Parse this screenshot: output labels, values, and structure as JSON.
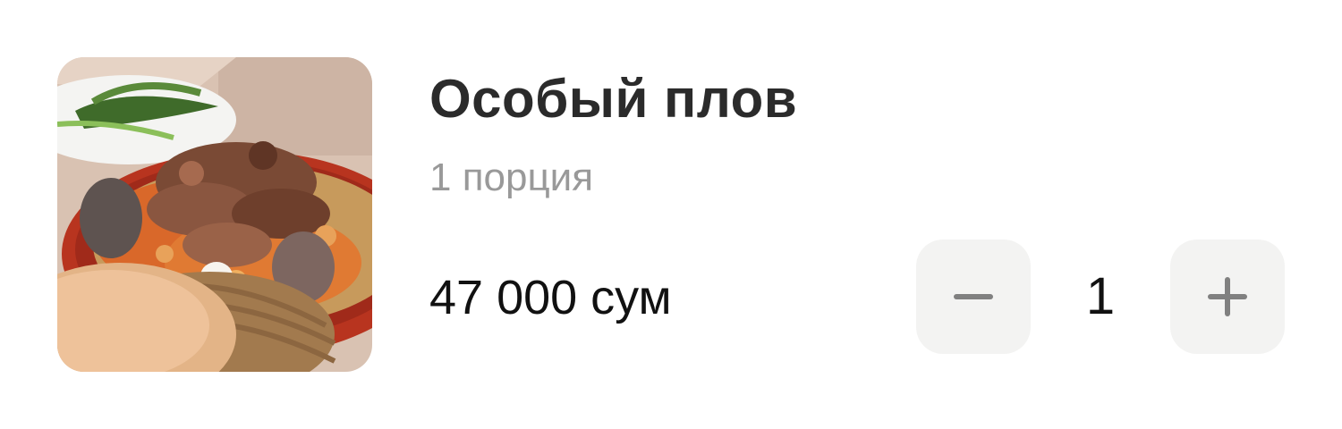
{
  "item": {
    "title": "Особый плов",
    "portion": "1 порция",
    "price": "47 000 сум",
    "image_icon": "plov-dish-photo"
  },
  "quantity": {
    "value": "1",
    "decrement_icon": "minus-icon",
    "increment_icon": "plus-icon"
  },
  "colors": {
    "title": "#2b2b2b",
    "portion": "#999999",
    "button_bg": "#f3f3f2",
    "button_icon": "#808080"
  }
}
